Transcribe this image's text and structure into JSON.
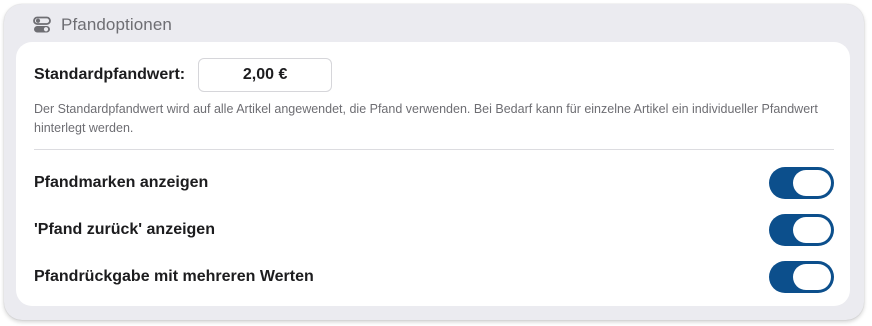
{
  "panel": {
    "title": "Pfandoptionen",
    "icon": "toggles-icon"
  },
  "default_deposit": {
    "label": "Standardpfandwert:",
    "value": "2,00 €",
    "hint": "Der Standardpfandwert wird auf alle Artikel angewendet, die Pfand verwenden. Bei Bedarf kann für einzelne Artikel ein individueller Pfandwert hinterlegt werden."
  },
  "options": [
    {
      "label": "Pfandmarken anzeigen",
      "enabled": true
    },
    {
      "label": "'Pfand zurück' anzeigen",
      "enabled": true
    },
    {
      "label": "Pfandrückgabe mit mehreren Werten",
      "enabled": true
    }
  ],
  "colors": {
    "toggle_on": "#0c4f8c",
    "card_background": "#ebebf0"
  }
}
